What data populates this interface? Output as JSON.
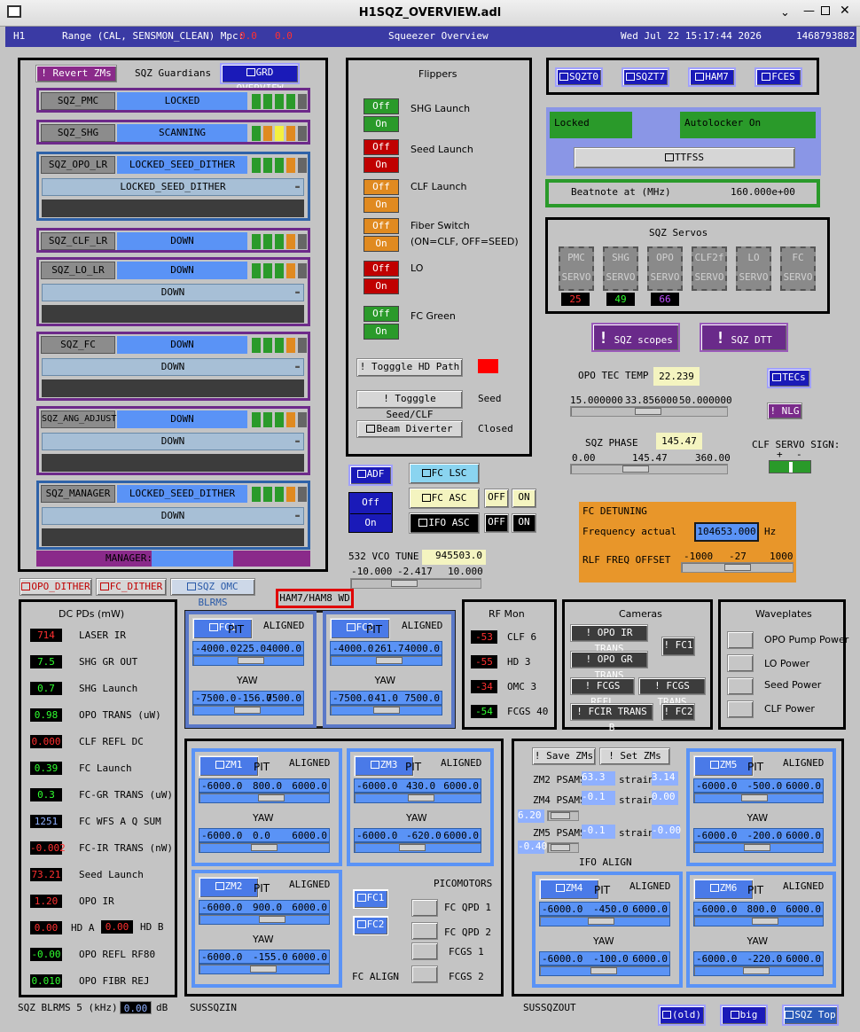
{
  "window": {
    "title": "H1SQZ_OVERVIEW.adl"
  },
  "header": {
    "site": "H1",
    "range": "Range (CAL, SENSMON_CLEAN) Mpc:",
    "range_v1": "0.0",
    "range_v2": "0.0",
    "center": "Squeezer Overview",
    "date": "Wed Jul 22 15:17:44 2026",
    "gps": "1468793882"
  },
  "guardians": {
    "revert": "! Revert ZMs",
    "title": "SQZ Guardians",
    "overview": "GRD OVERVIEW",
    "pmc": {
      "name": "SQZ_PMC",
      "state": "LOCKED"
    },
    "shg": {
      "name": "SQZ_SHG",
      "state": "SCANNING"
    },
    "opo": {
      "name": "SQZ_OPO_LR",
      "state": "LOCKED_SEED_DITHER",
      "sel": "LOCKED_SEED_DITHER"
    },
    "clf": {
      "name": "SQZ_CLF_LR",
      "state": "DOWN"
    },
    "lo": {
      "name": "SQZ_LO_LR",
      "state": "DOWN",
      "sel": "DOWN"
    },
    "fc": {
      "name": "SQZ_FC",
      "state": "DOWN",
      "sel": "DOWN"
    },
    "ang": {
      "name": "SQZ_ANG_ADJUST",
      "state": "DOWN",
      "sel": "DOWN"
    },
    "mgr": {
      "name": "SQZ_MANAGER",
      "state": "LOCKED_SEED_DITHER",
      "sel": "DOWN"
    },
    "manager_label": "MANAGER:"
  },
  "dither": {
    "opo": "OPO_DITHER",
    "fc": "FC_DITHER",
    "omc": "SQZ OMC BLRMS"
  },
  "flippers": {
    "title": "Flippers",
    "off": "Off",
    "on": "On",
    "items": [
      "SHG Launch",
      "Seed Launch",
      "CLF Launch",
      "Fiber Switch",
      "(ON=CLF, OFF=SEED)",
      "LO",
      "FC Green"
    ],
    "hd": "! Togggle HD Path",
    "seedclf": "! Togggle Seed/CLF",
    "seed_state": "Seed",
    "beam": "Beam Diverter",
    "beam_state": "Closed"
  },
  "top_links": [
    "SQZT0",
    "SQZT7",
    "HAM7",
    "FCES"
  ],
  "ttfss": {
    "locked": "Locked",
    "auto": "Autolocker On",
    "btn": "TTFSS",
    "beat_label": "Beatnote at (MHz)",
    "beat_val": "160.000e+00"
  },
  "servos": {
    "title": "SQZ Servos",
    "names": [
      [
        "PMC",
        "SERVO"
      ],
      [
        "SHG",
        "SERVO"
      ],
      [
        "OPO",
        "SERVO"
      ],
      [
        "CLF2f",
        "SERVO"
      ],
      [
        "LO",
        "SERVO"
      ],
      [
        "FC",
        "SERVO"
      ]
    ],
    "vals": [
      "25",
      "49",
      "66"
    ],
    "scopes": "SQZ scopes",
    "dtt": "SQZ DTT"
  },
  "tec": {
    "label": "OPO TEC TEMP",
    "val": "22.239",
    "min": "15.000000",
    "mid": "33.856000",
    "max": "50.000000",
    "tecs": "TECs",
    "nlg": "! NLG",
    "level": 0.5
  },
  "phase": {
    "label": "SQZ PHASE",
    "val": "145.47",
    "min": "0.00",
    "mid": "145.47",
    "max": "360.00",
    "clf_sign": "CLF SERVO SIGN:",
    "plus": "+",
    "minus": "-",
    "level": 0.404
  },
  "adf": {
    "btn": "ADF",
    "off": "Off",
    "on": "On"
  },
  "asc": {
    "fclsc": "FC LSC",
    "fcasc": "FC ASC",
    "ifoasc": "IFO ASC",
    "off": "OFF",
    "on": "ON"
  },
  "detune": {
    "title": "FC DETUNING",
    "freq_label": "Frequency actual",
    "freq": "104653.000",
    "unit": "Hz",
    "rlf_label": "RLF FREQ OFFSET",
    "min": "-1000",
    "mid": "-27",
    "max": "1000"
  },
  "vco": {
    "label": "532 VCO TUNE",
    "val": "945503.0",
    "min": "-10.000",
    "mid": "-2.417",
    "max": "10.000"
  },
  "wd": "HAM7/HAM8 WD",
  "pds": {
    "title": "DC PDs (mW)",
    "items": [
      {
        "v": "714",
        "n": "LASER IR",
        "c": "#ff3030"
      },
      {
        "v": "7.5",
        "n": "SHG GR OUT",
        "c": "#30ff30"
      },
      {
        "v": "0.7",
        "n": "SHG Launch",
        "c": "#30ff30"
      },
      {
        "v": "0.98",
        "n": "OPO TRANS (uW)",
        "c": "#30ff30"
      },
      {
        "v": "0.000",
        "n": "CLF REFL DC",
        "c": "#ff3030"
      },
      {
        "v": "0.39",
        "n": "FC Launch",
        "c": "#30ff30"
      },
      {
        "v": "0.3",
        "n": "FC-GR TRANS (uW)",
        "c": "#30ff30"
      },
      {
        "v": "1251",
        "n": "FC WFS A Q SUM",
        "c": "#8fb0ff"
      },
      {
        "v": "-0.002",
        "n": "FC-IR TRANS (nW)",
        "c": "#ff3030"
      },
      {
        "v": "73.21",
        "n": "Seed Launch",
        "c": "#ff3030"
      },
      {
        "v": "1.20",
        "n": "OPO IR",
        "c": "#ff3030"
      },
      {
        "v": "0.00",
        "n": "HD A",
        "c": "#ff3030"
      },
      {
        "v": "-0.00",
        "n": "OPO REFL RF80",
        "c": "#30ff30"
      },
      {
        "v": "0.010",
        "n": "OPO FIBR REJ",
        "c": "#30ff30"
      }
    ],
    "hdb_v": "0.00",
    "hdb_n": "HD B"
  },
  "blrms": {
    "label": "SQZ BLRMS 5 (kHz):",
    "val": "0.00",
    "unit": "dB"
  },
  "rf": {
    "title": "RF Mon",
    "items": [
      {
        "v": "-53",
        "n": "CLF 6",
        "c": "#ff3030"
      },
      {
        "v": "-55",
        "n": "HD 3",
        "c": "#ff3030"
      },
      {
        "v": "-34",
        "n": "OMC 3",
        "c": "#ff3030"
      },
      {
        "v": "-54",
        "n": "FCGS 40",
        "c": "#30ff30"
      }
    ]
  },
  "cams": {
    "title": "Cameras",
    "b": [
      "! OPO IR TRANS",
      "! FC1",
      "! OPO GR TRANS",
      "! FCGS REFL",
      "! FCGS TRANS",
      "! FCIR TRANS B",
      "! FC2"
    ]
  },
  "wave": {
    "title": "Waveplates",
    "items": [
      "OPO Pump Power",
      "LO Power",
      "Seed Power",
      "CLF Power"
    ]
  },
  "susp": {
    "pit": "PIT",
    "yaw": "YAW",
    "aligned": "ALIGNED",
    "fc1": {
      "name": "FC1",
      "pmin": "-4000.0",
      "pval": "225.0",
      "pmax": "4000.0",
      "ymin": "-7500.0",
      "yval": "-156.0",
      "ymax": "7500.0"
    },
    "fc2": {
      "name": "FC2",
      "pmin": "-4000.0",
      "pval": "261.7",
      "pmax": "4000.0",
      "ymin": "-7500.0",
      "yval": "41.0",
      "ymax": "7500.0"
    },
    "zm1": {
      "name": "ZM1",
      "pmin": "-6000.0",
      "pval": "800.0",
      "pmax": "6000.0",
      "ymin": "-6000.0",
      "yval": "0.0",
      "ymax": "6000.0"
    },
    "zm3": {
      "name": "ZM3",
      "pmin": "-6000.0",
      "pval": "430.0",
      "pmax": "6000.0",
      "ymin": "-6000.0",
      "yval": "-620.0",
      "ymax": "6000.0"
    },
    "zm2": {
      "name": "ZM2",
      "pmin": "-6000.0",
      "pval": "900.0",
      "pmax": "6000.0",
      "ymin": "-6000.0",
      "yval": "-155.0",
      "ymax": "6000.0"
    },
    "zm5": {
      "name": "ZM5",
      "pmin": "-6000.0",
      "pval": "-500.0",
      "pmax": "6000.0",
      "ymin": "-6000.0",
      "yval": "-200.0",
      "ymax": "6000.0"
    },
    "zm4": {
      "name": "ZM4",
      "pmin": "-6000.0",
      "pval": "-450.0",
      "pmax": "6000.0",
      "ymin": "-6000.0",
      "yval": "-100.0",
      "ymax": "6000.0"
    },
    "zm6": {
      "name": "ZM6",
      "pmin": "-6000.0",
      "pval": "800.0",
      "pmax": "6000.0",
      "ymin": "-6000.0",
      "yval": "-220.0",
      "ymax": "6000.0"
    }
  },
  "pico": {
    "title": "PICOMOTORS",
    "fc1": "FC1",
    "fc2": "FC2",
    "items": [
      "FC QPD 1",
      "FC QPD 2",
      "FCGS 1",
      "FCGS 2"
    ],
    "fcalign": "FC ALIGN",
    "susin": "SUSSQZIN"
  },
  "ifoalign": {
    "save": "! Save ZMs",
    "set": "! Set ZMs",
    "zm2": "ZM2 PSAMS",
    "zm2v": "63.3",
    "zm2s": "3.14",
    "zm4": "ZM4 PSAMS",
    "zm4v": "-0.1",
    "zm4s": "0.00",
    "zm4l": "6.20",
    "zm5": "ZM5 PSAMS",
    "zm5v": "-0.1",
    "zm5s": "-0.00",
    "zm5l": "-0.40",
    "strain": "strain",
    "title": "IFO ALIGN",
    "susout": "SUSSQZOUT"
  },
  "bottom": {
    "old": "(old)",
    "big": "big",
    "top": "SQZ Top"
  }
}
